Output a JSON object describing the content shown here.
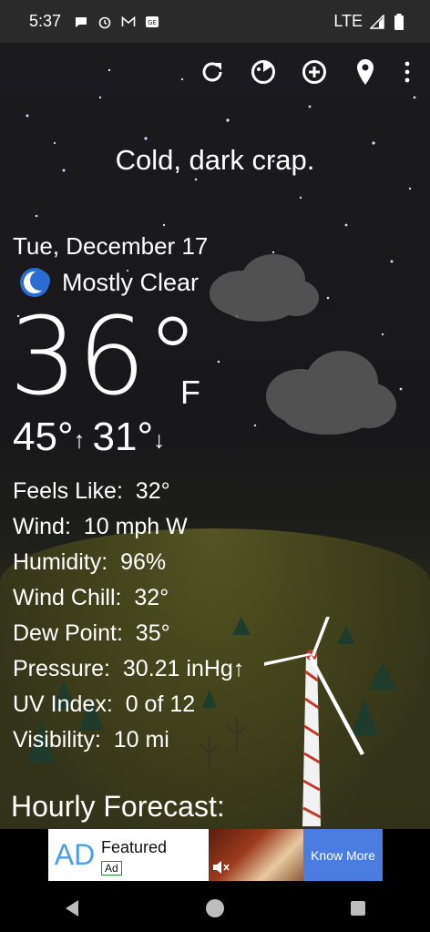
{
  "status_bar": {
    "time": "5:37",
    "network": "LTE",
    "icons": [
      "message-icon",
      "alarm-icon",
      "gmail-icon",
      "ge-icon",
      "signal-icon",
      "battery-icon"
    ]
  },
  "toolbar": {
    "icons": [
      "refresh-icon",
      "radar-icon",
      "add-location-icon",
      "location-icon",
      "overflow-menu-icon"
    ]
  },
  "weather": {
    "tagline": "Cold, dark crap.",
    "date": "Tue, December 17",
    "condition": "Mostly Clear",
    "condition_icon": "moon-icon",
    "temperature": "36°",
    "unit": "F",
    "high": "45°",
    "low": "31°",
    "details": [
      {
        "label": "Feels Like:",
        "value": "32°"
      },
      {
        "label": "Wind:",
        "value": "10 mph W"
      },
      {
        "label": "Humidity:",
        "value": "96%"
      },
      {
        "label": "Wind Chill:",
        "value": "32°"
      },
      {
        "label": "Dew Point:",
        "value": "35°"
      },
      {
        "label": "Pressure:",
        "value": "30.21 inHg↑"
      },
      {
        "label": "UV Index:",
        "value": "0 of 12"
      },
      {
        "label": "Visibility:",
        "value": "10 mi"
      }
    ],
    "hourly_title": "Hourly Forecast:"
  },
  "ad": {
    "logo": "AD",
    "title": "Featured",
    "badge": "Ad",
    "cta": "Know More"
  },
  "nav": {
    "icons": [
      "back-icon",
      "home-icon",
      "recents-icon"
    ]
  }
}
